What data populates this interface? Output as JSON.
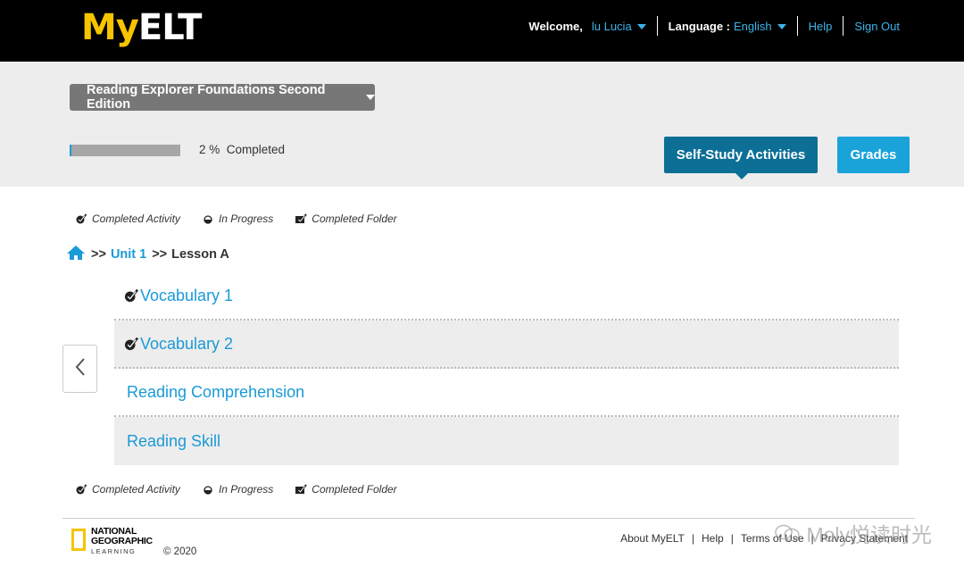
{
  "header": {
    "logo_my": "My",
    "logo_elt": "ELT",
    "welcome_label": "Welcome,",
    "user_name": "lu Lucia",
    "language_label": "Language :",
    "language_value": "English",
    "help": "Help",
    "sign_out": "Sign Out"
  },
  "course": {
    "title": "Reading Explorer Foundations Second Edition",
    "progress_percent": 2,
    "progress_label": "2 %  Completed"
  },
  "tabs": {
    "self_study": "Self-Study Activities",
    "grades": "Grades"
  },
  "legend": {
    "completed_activity": "Completed Activity",
    "in_progress": "In Progress",
    "completed_folder": "Completed Folder"
  },
  "breadcrumb": {
    "sep1": ">>",
    "unit": "Unit 1",
    "sep2": ">>",
    "lesson": "Lesson A"
  },
  "activities": [
    {
      "label": "Vocabulary 1",
      "completed": true
    },
    {
      "label": "Vocabulary 2",
      "completed": true
    },
    {
      "label": "Reading Comprehension",
      "completed": false
    },
    {
      "label": "Reading Skill",
      "completed": false
    }
  ],
  "footer": {
    "brand_line1": "NATIONAL",
    "brand_line2": "GEOGRAPHIC",
    "brand_line3": "LEARNING",
    "copyright": "© 2020",
    "about": "About MyELT",
    "help": "Help",
    "terms": "Terms of Use",
    "privacy": "Privacy Statement",
    "sep": "|"
  },
  "watermark": "Moly悦读时光",
  "colors": {
    "accent_blue": "#1a9ad6",
    "self_study_bg": "#0d6f96",
    "grades_bg": "#1aa3d9",
    "logo_yellow": "#f6c400"
  }
}
